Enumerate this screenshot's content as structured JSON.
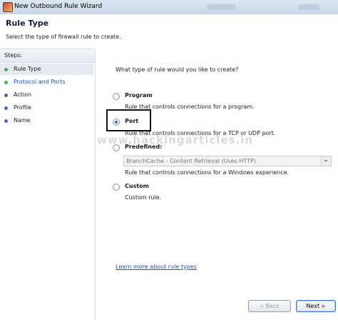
{
  "window": {
    "title": "New Outbound Rule Wizard"
  },
  "header": {
    "title": "Rule Type",
    "subtitle": "Select the type of firewall rule to create."
  },
  "steps": {
    "heading": "Steps:",
    "items": [
      {
        "label": "Rule Type",
        "active": true
      },
      {
        "label": "Protocol and Ports",
        "active": false
      },
      {
        "label": "Action",
        "active": false
      },
      {
        "label": "Profile",
        "active": false
      },
      {
        "label": "Name",
        "active": false
      }
    ]
  },
  "main": {
    "question": "What type of rule would you like to create?",
    "options": [
      {
        "label": "Program",
        "description": "Rule that controls connections for a program.",
        "checked": false
      },
      {
        "label": "Port",
        "description": "Rule that controls connections for a TCP or UDP port.",
        "checked": true
      },
      {
        "label": "Predefined:",
        "select_value": "BranchCache - Content Retrieval (Uses HTTP)",
        "description": "Rule that controls connections for a Windows experience.",
        "checked": false
      },
      {
        "label": "Custom",
        "description": "Custom rule.",
        "checked": false
      }
    ],
    "learn_more": "Learn more about rule types"
  },
  "buttons": {
    "back": "Back",
    "next": "Next",
    "back_glyph": "<",
    "next_glyph": ">"
  },
  "watermark": {
    "text": "www.hackingarticles.in"
  },
  "colors": {
    "link": "#1f4fb5",
    "step_done": "#3bb24a",
    "step_pending": "#4f5fbf",
    "radio_dot": "#2a6bd0"
  }
}
